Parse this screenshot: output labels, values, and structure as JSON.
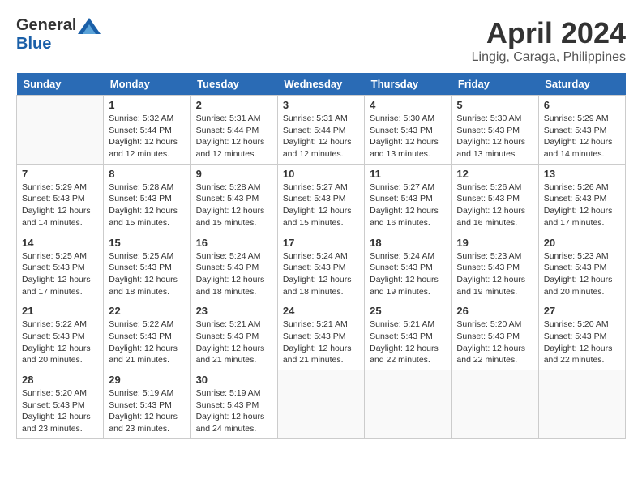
{
  "header": {
    "logo_general": "General",
    "logo_blue": "Blue",
    "month_title": "April 2024",
    "location": "Lingig, Caraga, Philippines"
  },
  "calendar": {
    "days_of_week": [
      "Sunday",
      "Monday",
      "Tuesday",
      "Wednesday",
      "Thursday",
      "Friday",
      "Saturday"
    ],
    "weeks": [
      [
        {
          "day": "",
          "info": ""
        },
        {
          "day": "1",
          "info": "Sunrise: 5:32 AM\nSunset: 5:44 PM\nDaylight: 12 hours\nand 12 minutes."
        },
        {
          "day": "2",
          "info": "Sunrise: 5:31 AM\nSunset: 5:44 PM\nDaylight: 12 hours\nand 12 minutes."
        },
        {
          "day": "3",
          "info": "Sunrise: 5:31 AM\nSunset: 5:44 PM\nDaylight: 12 hours\nand 12 minutes."
        },
        {
          "day": "4",
          "info": "Sunrise: 5:30 AM\nSunset: 5:43 PM\nDaylight: 12 hours\nand 13 minutes."
        },
        {
          "day": "5",
          "info": "Sunrise: 5:30 AM\nSunset: 5:43 PM\nDaylight: 12 hours\nand 13 minutes."
        },
        {
          "day": "6",
          "info": "Sunrise: 5:29 AM\nSunset: 5:43 PM\nDaylight: 12 hours\nand 14 minutes."
        }
      ],
      [
        {
          "day": "7",
          "info": "Sunrise: 5:29 AM\nSunset: 5:43 PM\nDaylight: 12 hours\nand 14 minutes."
        },
        {
          "day": "8",
          "info": "Sunrise: 5:28 AM\nSunset: 5:43 PM\nDaylight: 12 hours\nand 15 minutes."
        },
        {
          "day": "9",
          "info": "Sunrise: 5:28 AM\nSunset: 5:43 PM\nDaylight: 12 hours\nand 15 minutes."
        },
        {
          "day": "10",
          "info": "Sunrise: 5:27 AM\nSunset: 5:43 PM\nDaylight: 12 hours\nand 15 minutes."
        },
        {
          "day": "11",
          "info": "Sunrise: 5:27 AM\nSunset: 5:43 PM\nDaylight: 12 hours\nand 16 minutes."
        },
        {
          "day": "12",
          "info": "Sunrise: 5:26 AM\nSunset: 5:43 PM\nDaylight: 12 hours\nand 16 minutes."
        },
        {
          "day": "13",
          "info": "Sunrise: 5:26 AM\nSunset: 5:43 PM\nDaylight: 12 hours\nand 17 minutes."
        }
      ],
      [
        {
          "day": "14",
          "info": "Sunrise: 5:25 AM\nSunset: 5:43 PM\nDaylight: 12 hours\nand 17 minutes."
        },
        {
          "day": "15",
          "info": "Sunrise: 5:25 AM\nSunset: 5:43 PM\nDaylight: 12 hours\nand 18 minutes."
        },
        {
          "day": "16",
          "info": "Sunrise: 5:24 AM\nSunset: 5:43 PM\nDaylight: 12 hours\nand 18 minutes."
        },
        {
          "day": "17",
          "info": "Sunrise: 5:24 AM\nSunset: 5:43 PM\nDaylight: 12 hours\nand 18 minutes."
        },
        {
          "day": "18",
          "info": "Sunrise: 5:24 AM\nSunset: 5:43 PM\nDaylight: 12 hours\nand 19 minutes."
        },
        {
          "day": "19",
          "info": "Sunrise: 5:23 AM\nSunset: 5:43 PM\nDaylight: 12 hours\nand 19 minutes."
        },
        {
          "day": "20",
          "info": "Sunrise: 5:23 AM\nSunset: 5:43 PM\nDaylight: 12 hours\nand 20 minutes."
        }
      ],
      [
        {
          "day": "21",
          "info": "Sunrise: 5:22 AM\nSunset: 5:43 PM\nDaylight: 12 hours\nand 20 minutes."
        },
        {
          "day": "22",
          "info": "Sunrise: 5:22 AM\nSunset: 5:43 PM\nDaylight: 12 hours\nand 21 minutes."
        },
        {
          "day": "23",
          "info": "Sunrise: 5:21 AM\nSunset: 5:43 PM\nDaylight: 12 hours\nand 21 minutes."
        },
        {
          "day": "24",
          "info": "Sunrise: 5:21 AM\nSunset: 5:43 PM\nDaylight: 12 hours\nand 21 minutes."
        },
        {
          "day": "25",
          "info": "Sunrise: 5:21 AM\nSunset: 5:43 PM\nDaylight: 12 hours\nand 22 minutes."
        },
        {
          "day": "26",
          "info": "Sunrise: 5:20 AM\nSunset: 5:43 PM\nDaylight: 12 hours\nand 22 minutes."
        },
        {
          "day": "27",
          "info": "Sunrise: 5:20 AM\nSunset: 5:43 PM\nDaylight: 12 hours\nand 22 minutes."
        }
      ],
      [
        {
          "day": "28",
          "info": "Sunrise: 5:20 AM\nSunset: 5:43 PM\nDaylight: 12 hours\nand 23 minutes."
        },
        {
          "day": "29",
          "info": "Sunrise: 5:19 AM\nSunset: 5:43 PM\nDaylight: 12 hours\nand 23 minutes."
        },
        {
          "day": "30",
          "info": "Sunrise: 5:19 AM\nSunset: 5:43 PM\nDaylight: 12 hours\nand 24 minutes."
        },
        {
          "day": "",
          "info": ""
        },
        {
          "day": "",
          "info": ""
        },
        {
          "day": "",
          "info": ""
        },
        {
          "day": "",
          "info": ""
        }
      ]
    ]
  }
}
